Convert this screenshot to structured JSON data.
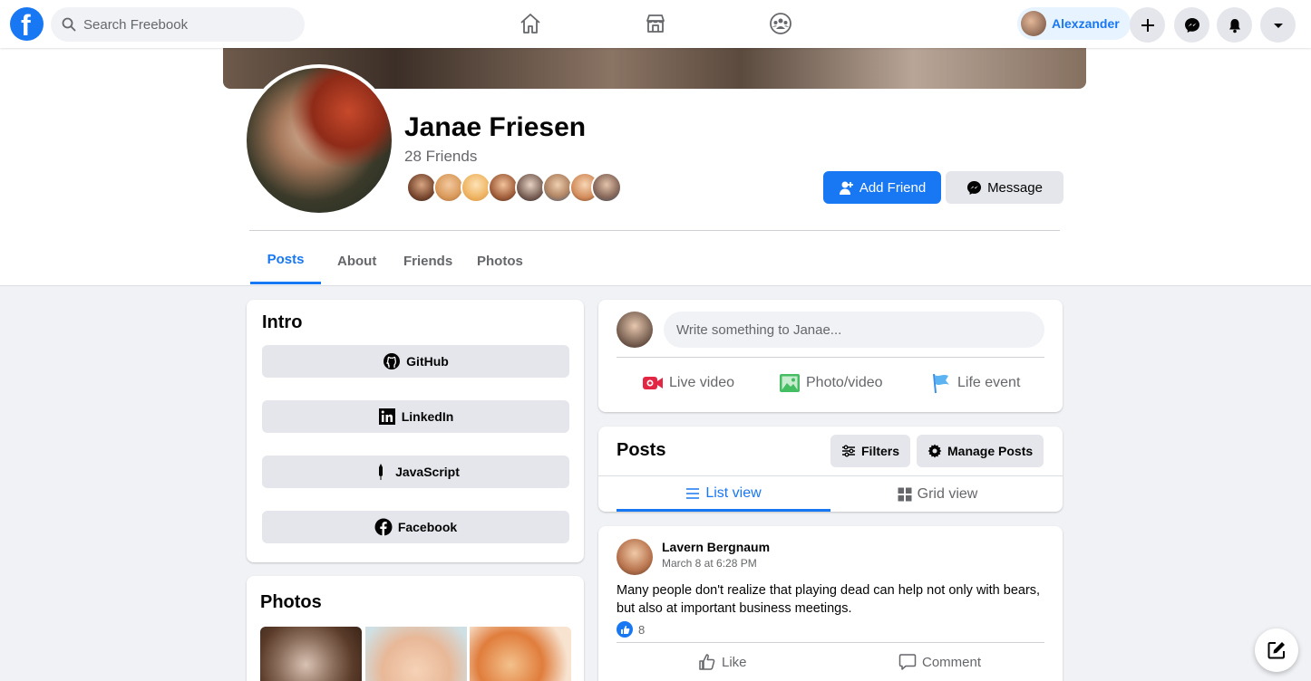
{
  "nav": {
    "search_placeholder": "Search Freebook",
    "user_name": "Alexzander"
  },
  "profile": {
    "name": "Janae Friesen",
    "friends_count": "28 Friends",
    "add_friend_label": "Add Friend",
    "message_label": "Message"
  },
  "tabs": [
    {
      "label": "Posts"
    },
    {
      "label": "About"
    },
    {
      "label": "Friends"
    },
    {
      "label": "Photos"
    }
  ],
  "intro": {
    "title": "Intro",
    "links": [
      {
        "label": "GitHub",
        "icon": "github-icon"
      },
      {
        "label": "LinkedIn",
        "icon": "linkedin-icon"
      },
      {
        "label": "JavaScript",
        "icon": "javascript-icon"
      },
      {
        "label": "Facebook",
        "icon": "facebook-icon"
      }
    ]
  },
  "photos": {
    "title": "Photos"
  },
  "composer": {
    "placeholder": "Write something to Janae...",
    "actions": [
      {
        "label": "Live video",
        "icon": "live-video-icon"
      },
      {
        "label": "Photo/video",
        "icon": "photo-icon"
      },
      {
        "label": "Life event",
        "icon": "flag-icon"
      }
    ]
  },
  "posts_panel": {
    "title": "Posts",
    "filters_label": "Filters",
    "manage_label": "Manage Posts",
    "list_view_label": "List view",
    "grid_view_label": "Grid view"
  },
  "post": {
    "author": "Lavern Bergnaum",
    "time": "March 8 at 6:28 PM",
    "text": "Many people don't realize that playing dead can help not only with bears, but also at important business meetings.",
    "likes": "8",
    "like_label": "Like",
    "comment_label": "Comment"
  },
  "colors": {
    "brand": "#1877f2",
    "background": "#f0f2f5",
    "button_gray": "#e4e6eb"
  }
}
